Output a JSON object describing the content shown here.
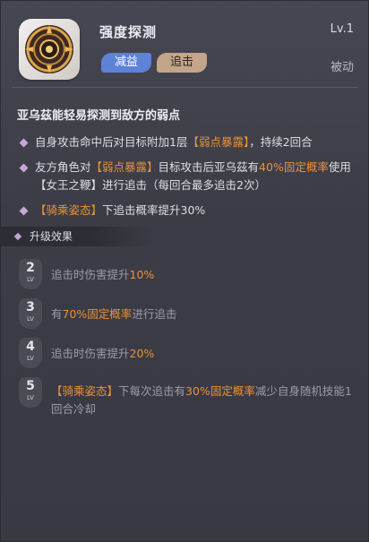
{
  "skill": {
    "name": "强度探测",
    "level": "Lv.1",
    "type": "被动",
    "tags": [
      "减益",
      "追击"
    ]
  },
  "description": {
    "title": "亚乌茲能轻易探测到敌方的弱点",
    "lines": [
      {
        "a": "自身攻击命中后对目标附加1层",
        "b": "【弱点暴露】",
        "c": "，持续2回合"
      },
      {
        "a": "友方角色对",
        "b": "【弱点暴露】",
        "c": "目标攻击后亚乌茲有",
        "d": "40%固定概率",
        "e": "使用【女王之鞭】进行追击（每回合最多追击2次）"
      },
      {
        "a": "【骑乘姿态】",
        "b": "下追击概率提升30%"
      }
    ]
  },
  "upgrade": {
    "heading": "升级效果",
    "lv_label": "LV",
    "items": [
      {
        "level": "2",
        "a": "追击时伤害提升",
        "b": "10%"
      },
      {
        "level": "3",
        "a": "有",
        "b": "70%固定概率",
        "c": "进行追击"
      },
      {
        "level": "4",
        "a": "追击时伤害提升",
        "b": "20%"
      },
      {
        "level": "5",
        "a": "【骑乘姿态】",
        "b": "下每次追击有",
        "c": "30%固定概率",
        "d": "减少自身随机技能1回合冷却"
      }
    ]
  },
  "colors": {
    "accent": "#e8923a",
    "tag_debuff": "#5d82d6",
    "tag_followup": "#c3a58a"
  }
}
